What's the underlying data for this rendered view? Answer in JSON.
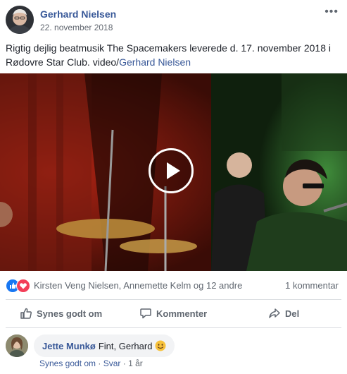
{
  "post": {
    "author": "Gerhard Nielsen",
    "date": "22. november 2018",
    "more_label": "•••",
    "text": "Rigtig dejlig beatmusik The Spacemakers leverede d. 17. november 2018 i Rødovre Star Club. video/",
    "text_link": "Gerhard Nielsen"
  },
  "reactions": {
    "icons": [
      "like-icon",
      "love-icon"
    ],
    "names": "Kirsten Veng Nielsen, Annemette Kelm og 12 andre",
    "comment_count": "1 kommentar"
  },
  "actions": {
    "like": "Synes godt om",
    "comment": "Kommenter",
    "share": "Del"
  },
  "comment": {
    "author": "Jette Munkø",
    "text": "Fint, Gerhard",
    "emoji": "smiling-face-icon",
    "like": "Synes godt om",
    "separator": "·",
    "reply": "Svar",
    "time": "1 år"
  },
  "colors": {
    "link": "#385898",
    "meta": "#606770",
    "like_blue": "#1877f2",
    "love_red": "#f33e58"
  }
}
